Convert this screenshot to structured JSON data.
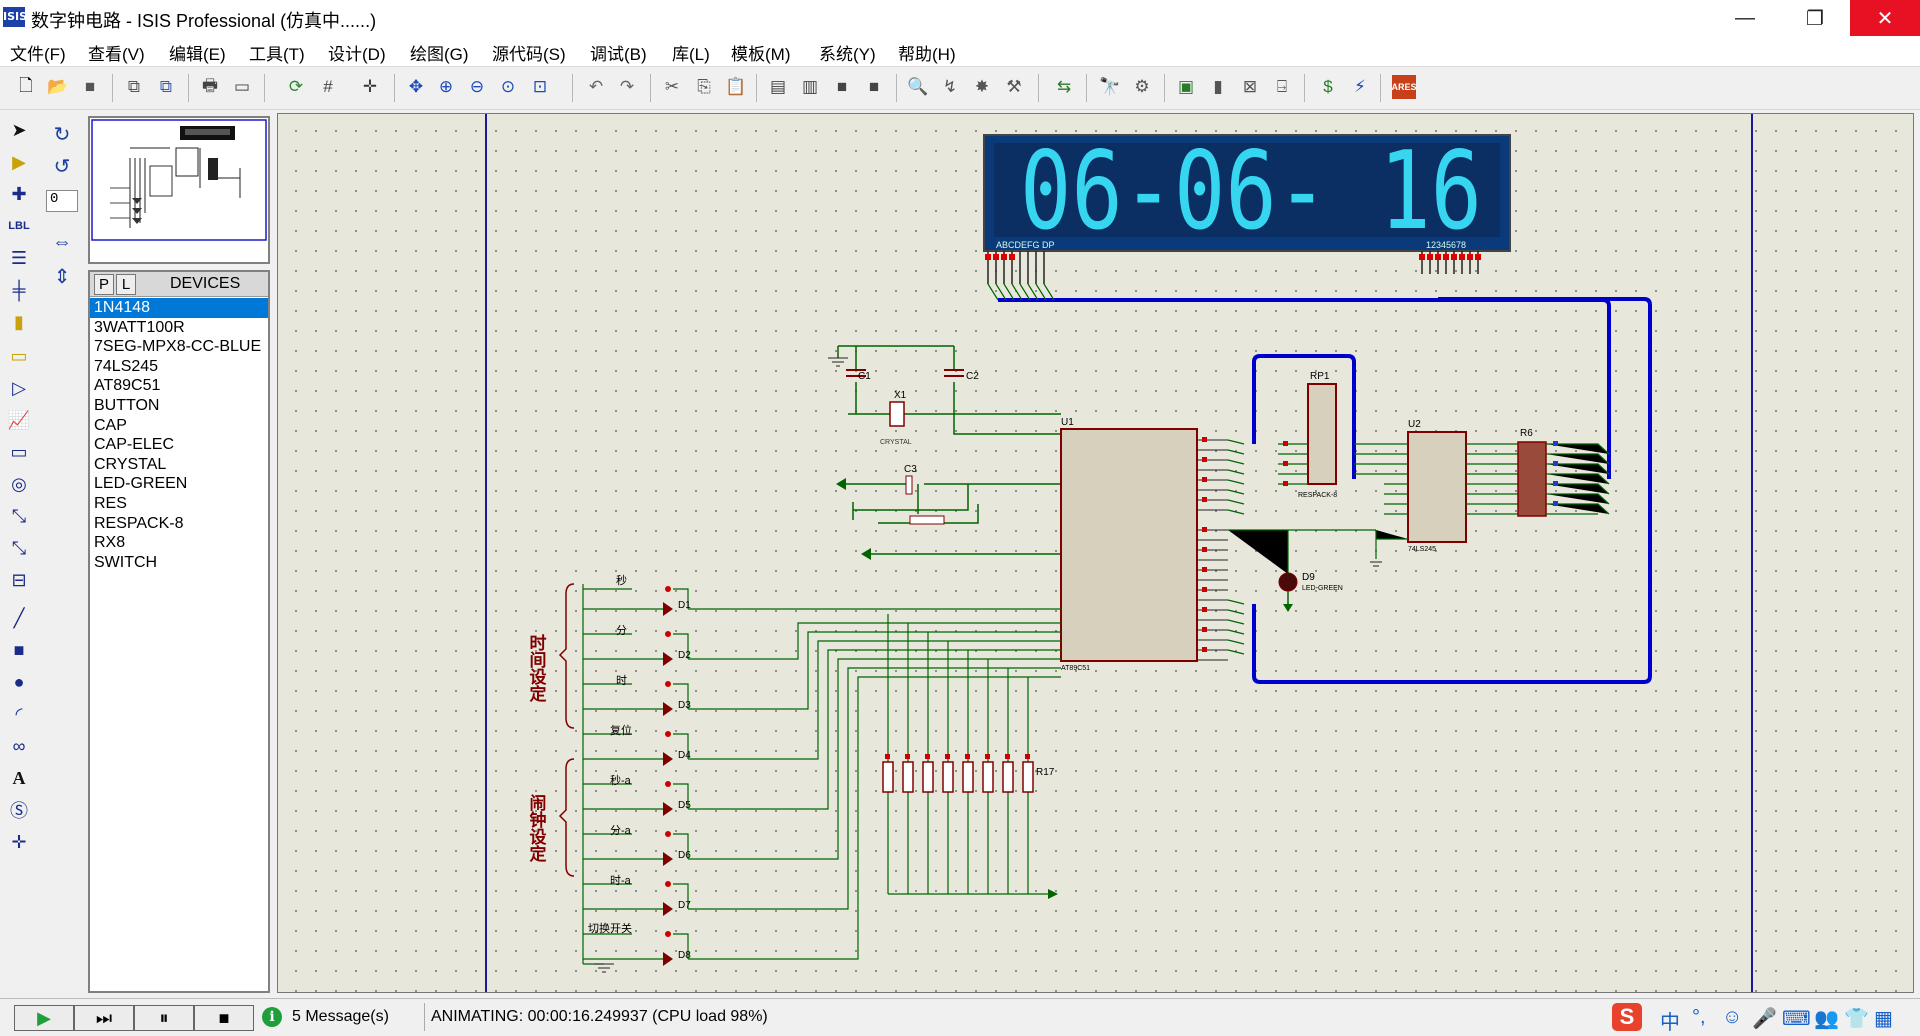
{
  "window": {
    "icon": "ISIS",
    "title": "数字钟电路 - ISIS Professional (仿真中......)",
    "minimize": "—",
    "restore": "❐",
    "close": "✕"
  },
  "menu": [
    "文件(F)",
    "查看(V)",
    "编辑(E)",
    "工具(T)",
    "设计(D)",
    "绘图(G)",
    "源代码(S)",
    "调试(B)",
    "库(L)",
    "模板(M)",
    "系统(Y)",
    "帮助(H)"
  ],
  "left_panel": {
    "angle": "0",
    "picker": {
      "p": "P",
      "l": "L",
      "title": "DEVICES"
    },
    "devices": [
      "1N4148",
      "3WATT100R",
      "7SEG-MPX8-CC-BLUE",
      "74LS245",
      "AT89C51",
      "BUTTON",
      "CAP",
      "CAP-ELEC",
      "CRYSTAL",
      "LED-GREEN",
      "RES",
      "RESPACK-8",
      "RX8",
      "SWITCH"
    ],
    "selected": "1N4148"
  },
  "schematic": {
    "display_text": "06-06- 16",
    "display_seg_label": "ABCDEFG DP",
    "display_dig_label": "12345678",
    "components": {
      "c1": "C1",
      "c2": "C2",
      "c3": "C3",
      "x1": "X1",
      "u1": "U1",
      "u2": "U2",
      "rp1": "RP1",
      "r6": "R6",
      "r17": "R17",
      "d9": "D9",
      "led": "LED-GREEN",
      "crystal": "CRYSTAL",
      "respack": "RESPACK-8",
      "mcu": "AT89C51",
      "buf": "74LS245"
    },
    "button_labels": [
      "秒",
      "分",
      "时",
      "复位",
      "秒-a",
      "分-a",
      "时-a",
      "切换开关"
    ],
    "diode_labels": [
      "D1",
      "D2",
      "D3",
      "D4",
      "D5",
      "D6",
      "D7",
      "D8"
    ],
    "group1": "时间设定",
    "group2": "闹钟设定"
  },
  "status": {
    "messages": "5 Message(s)",
    "text": "ANIMATING: 00:00:16.249937 (CPU load 98%)",
    "ime_lang": "中"
  },
  "colors": {
    "wire": "#006400",
    "bus": "#0000cc",
    "display_bg": "#0a3a7a",
    "segment": "#37d6f0",
    "component": "#800000"
  }
}
